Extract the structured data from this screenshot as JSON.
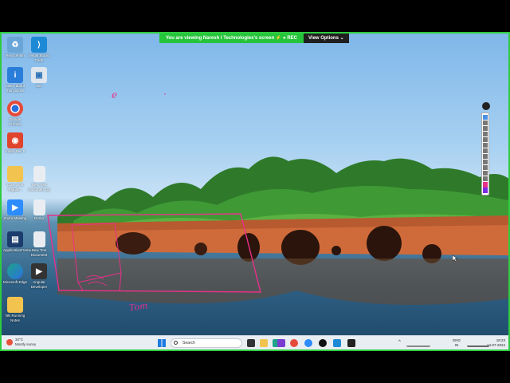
{
  "banner": {
    "viewing_text": "You are viewing  Naresh I Technologies's screen  ⚡  ● REC",
    "view_options": "View Options ⌄"
  },
  "desktop_icons": [
    {
      "label": "Recycle Bin",
      "icon": "recycle-bin-icon",
      "color": "#6aa5d8"
    },
    {
      "label": "Visual Studio Code",
      "icon": "vscode-icon",
      "color": "#1e8ad6"
    },
    {
      "label": "Learn about this picture",
      "icon": "info-icon",
      "color": "#2a7ed9"
    },
    {
      "label": "abc",
      "icon": "file-icon",
      "color": "#dfe6ee"
    },
    {
      "label": "Google Chrome",
      "icon": "chrome-icon",
      "color": "#e64a3b"
    },
    {
      "label": "Video Rec II",
      "icon": "video-recorder-icon",
      "color": "#e0442c"
    },
    {
      "label": "Core JS & Angular ..",
      "icon": "folder-icon",
      "color": "#f2c44f"
    },
    {
      "label": "New Text Document (2)",
      "icon": "text-document-icon",
      "color": "#e9edf2"
    },
    {
      "label": "Zoom Meeting",
      "icon": "zoom-icon",
      "color": "#2d8cff"
    },
    {
      "label": "Demo",
      "icon": "text-document-icon",
      "color": "#e9edf2"
    },
    {
      "label": "ApplicationFrame...",
      "icon": "app-window-icon",
      "color": "#1c3c6e"
    },
    {
      "label": "New Text Document",
      "icon": "text-document-icon",
      "color": "#e9edf2"
    },
    {
      "label": "Microsoft Edge",
      "icon": "edge-icon",
      "color": "#1fa38a"
    },
    {
      "label": "Angular Developer",
      "icon": "video-file-icon",
      "color": "#333333"
    },
    {
      "label": "NN Running Notes",
      "icon": "folder-icon",
      "color": "#f2c44f"
    }
  ],
  "annotations": {
    "handwritten_letter": "e",
    "handwritten_word": "Tom"
  },
  "taskbar": {
    "temperature": "34°C",
    "weather": "Mostly sunny",
    "search_placeholder": "Search",
    "language_1": "ENG",
    "language_2": "IN",
    "time": "18:23",
    "date": "14-07-2024"
  },
  "colors": {
    "accent_green": "#25c43a",
    "annotation_pink": "#e8308a"
  }
}
